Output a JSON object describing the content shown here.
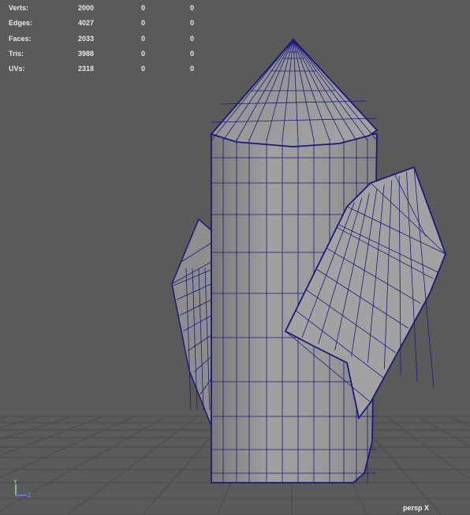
{
  "hud": {
    "rows": [
      {
        "label": "Verts:",
        "total": "2000",
        "selected": "0",
        "component": "0"
      },
      {
        "label": "Edges:",
        "total": "4027",
        "selected": "0",
        "component": "0"
      },
      {
        "label": "Faces:",
        "total": "2033",
        "selected": "0",
        "component": "0"
      },
      {
        "label": "Tris:",
        "total": "3988",
        "selected": "0",
        "component": "0"
      },
      {
        "label": "UVs:",
        "total": "2318",
        "selected": "0",
        "component": "0"
      }
    ]
  },
  "camera": {
    "label": "persp X"
  },
  "axis": {
    "y": "Y",
    "z": "Z"
  },
  "colors": {
    "background": "#5a5a5a",
    "grid": "#4e4e4e",
    "wireframe": "#1a1a7a",
    "surface": "#9a9a9a"
  }
}
